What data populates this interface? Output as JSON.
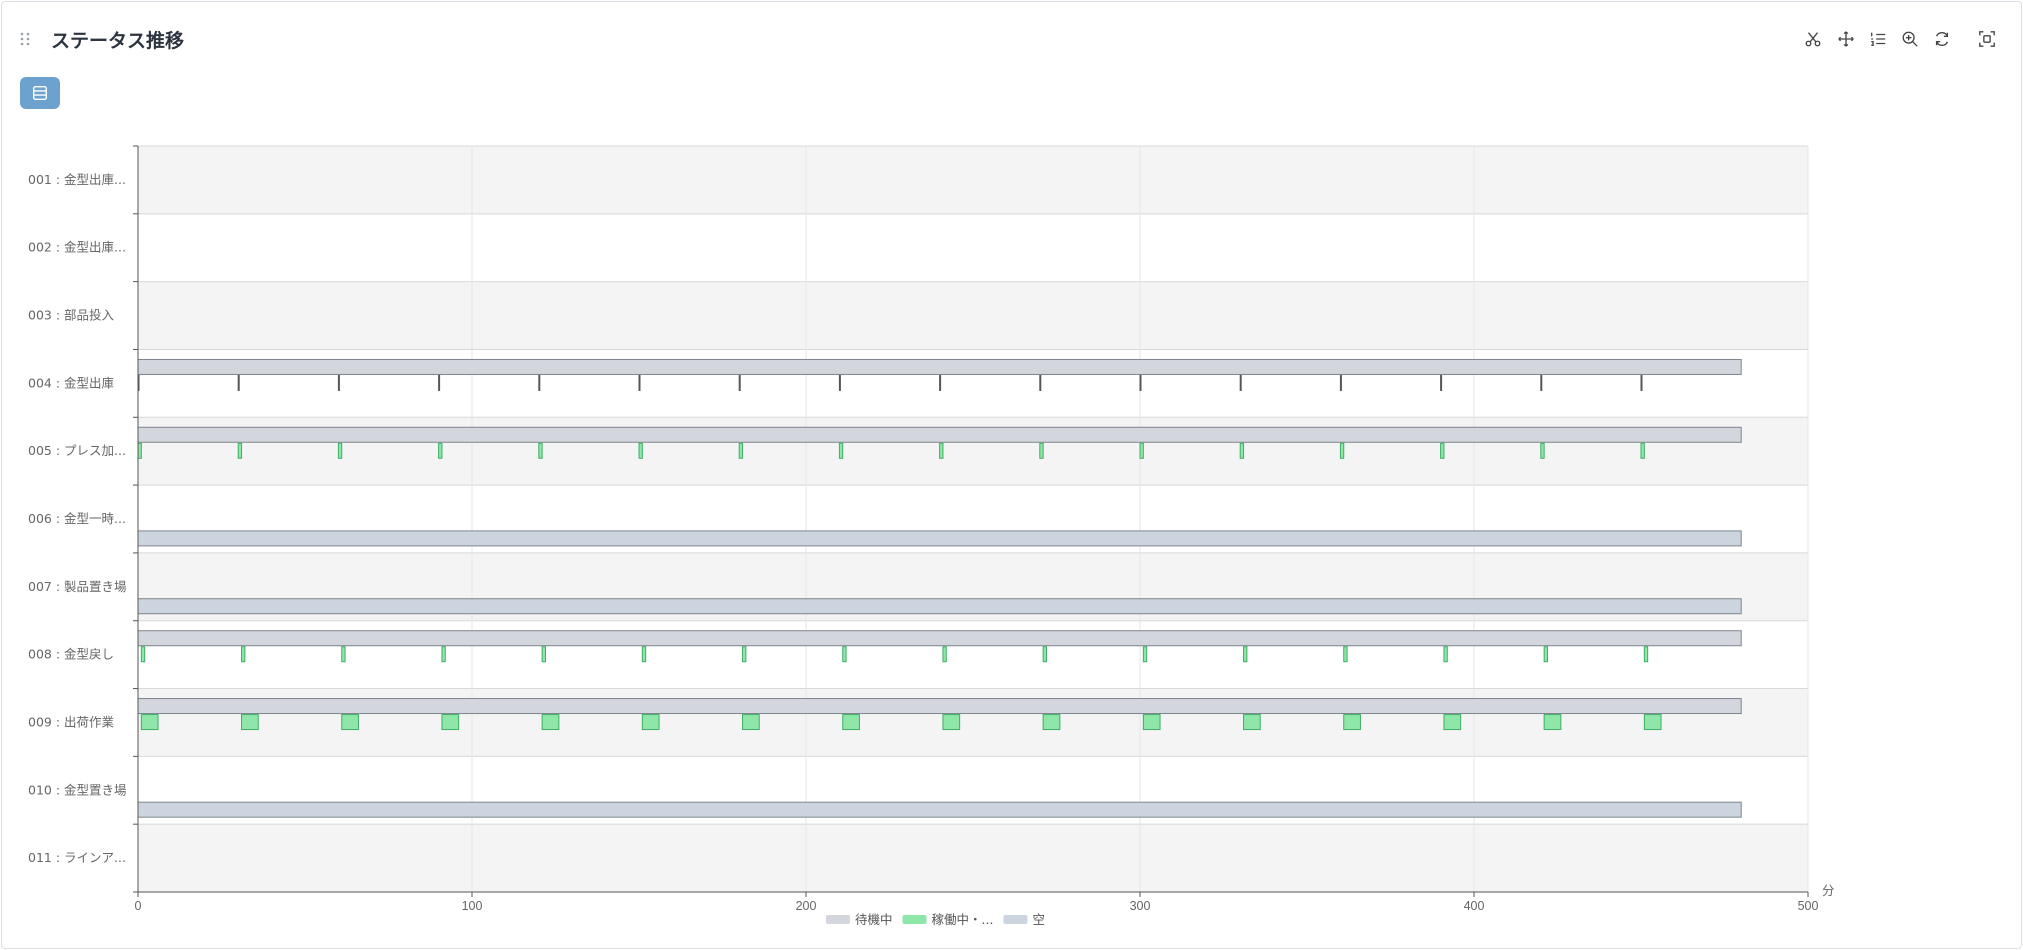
{
  "header": {
    "title": "ステータス推移"
  },
  "toolbar": {
    "icons": [
      "scissors-icon",
      "move-icon",
      "list-order-icon",
      "zoom-in-icon",
      "refresh-icon",
      "fullscreen-icon"
    ]
  },
  "colors": {
    "waiting": "#d3d6dd",
    "working": "#8ee6a8",
    "empty": "#ccd5df",
    "working_stroke": "#3fae66",
    "bar_stroke": "#7f848c",
    "band_alt": "#f4f4f4",
    "grid": "#e6e6e6"
  },
  "chart_data": {
    "type": "timeline",
    "title": "ステータス推移",
    "xlabel": "分",
    "xlim": [
      0,
      500
    ],
    "xticks": [
      0,
      100,
      200,
      300,
      400,
      500
    ],
    "grid": true,
    "legend_position": "bottom-center",
    "legend": [
      {
        "key": "waiting",
        "label": "待機中"
      },
      {
        "key": "working",
        "label": "稼働中・..."
      },
      {
        "key": "empty",
        "label": "空"
      }
    ],
    "categories": [
      "001 : 金型出庫...",
      "002 : 金型出庫...",
      "003 : 部品投入",
      "004 : 金型出庫",
      "005 : プレス加...",
      "006 : 金型一時...",
      "007 : 製品置き場",
      "008 : 金型戻し",
      "009 : 出荷作業",
      "010 : 金型置き場",
      "011 : ラインア..."
    ],
    "series": [
      {
        "category": 3,
        "status": "waiting",
        "intervals": [
          [
            0,
            480
          ]
        ]
      },
      {
        "category": 3,
        "status": "working",
        "periodic": {
          "first": 0,
          "step": 30,
          "count": 16,
          "duration": 0.05
        }
      },
      {
        "category": 4,
        "status": "waiting",
        "intervals": [
          [
            0,
            480
          ]
        ]
      },
      {
        "category": 4,
        "status": "working",
        "periodic": {
          "first": 0,
          "step": 30,
          "count": 16,
          "duration": 1
        }
      },
      {
        "category": 5,
        "status": "empty",
        "intervals": [
          [
            0,
            480
          ]
        ]
      },
      {
        "category": 6,
        "status": "empty",
        "intervals": [
          [
            0,
            480
          ]
        ]
      },
      {
        "category": 7,
        "status": "waiting",
        "intervals": [
          [
            0,
            480
          ]
        ]
      },
      {
        "category": 7,
        "status": "working",
        "periodic": {
          "first": 1,
          "step": 30,
          "count": 16,
          "duration": 1
        }
      },
      {
        "category": 8,
        "status": "waiting",
        "intervals": [
          [
            0,
            480
          ]
        ]
      },
      {
        "category": 8,
        "status": "working",
        "periodic": {
          "first": 1,
          "step": 30,
          "count": 16,
          "duration": 5
        }
      },
      {
        "category": 9,
        "status": "empty",
        "intervals": [
          [
            0,
            480
          ]
        ]
      }
    ]
  }
}
